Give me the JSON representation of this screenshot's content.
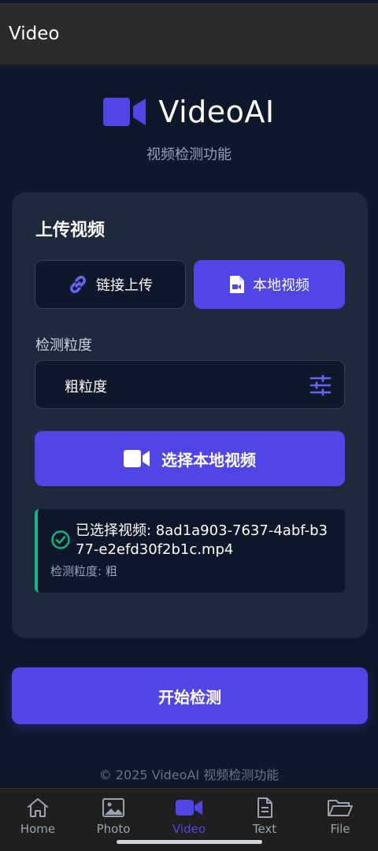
{
  "appbar": {
    "title": "Video"
  },
  "brand": {
    "name": "VideoAI",
    "subtitle": "视频检测功能"
  },
  "upload_card": {
    "title": "上传视频",
    "tabs": [
      {
        "label": "链接上传",
        "icon": "link-icon",
        "selected": false
      },
      {
        "label": "本地视频",
        "icon": "video-file-icon",
        "selected": true
      }
    ],
    "granularity": {
      "label": "检测粒度",
      "selected": "粗粒度"
    },
    "pick_button": {
      "label": "选择本地视频",
      "icon": "video-camera-icon"
    },
    "selection": {
      "file_text": "已选择视频: 8ad1a903-7637-4abf-b377-e2efd30f2b1c.mp4",
      "granularity_text": "检测粒度: 粗"
    }
  },
  "start_button": {
    "label": "开始检测"
  },
  "footer": {
    "text": "© 2025 VideoAI 视频检测功能"
  },
  "bottom_nav": {
    "items": [
      {
        "label": "Home",
        "icon": "home-icon",
        "active": false
      },
      {
        "label": "Photo",
        "icon": "photo-icon",
        "active": false
      },
      {
        "label": "Video",
        "icon": "video-icon",
        "active": true
      },
      {
        "label": "Text",
        "icon": "text-document-icon",
        "active": false
      },
      {
        "label": "File",
        "icon": "folder-icon",
        "active": false
      }
    ]
  },
  "colors": {
    "accent": "#4f46e5",
    "success": "#10b981",
    "background": "#0f172a",
    "card": "#1e293b"
  }
}
